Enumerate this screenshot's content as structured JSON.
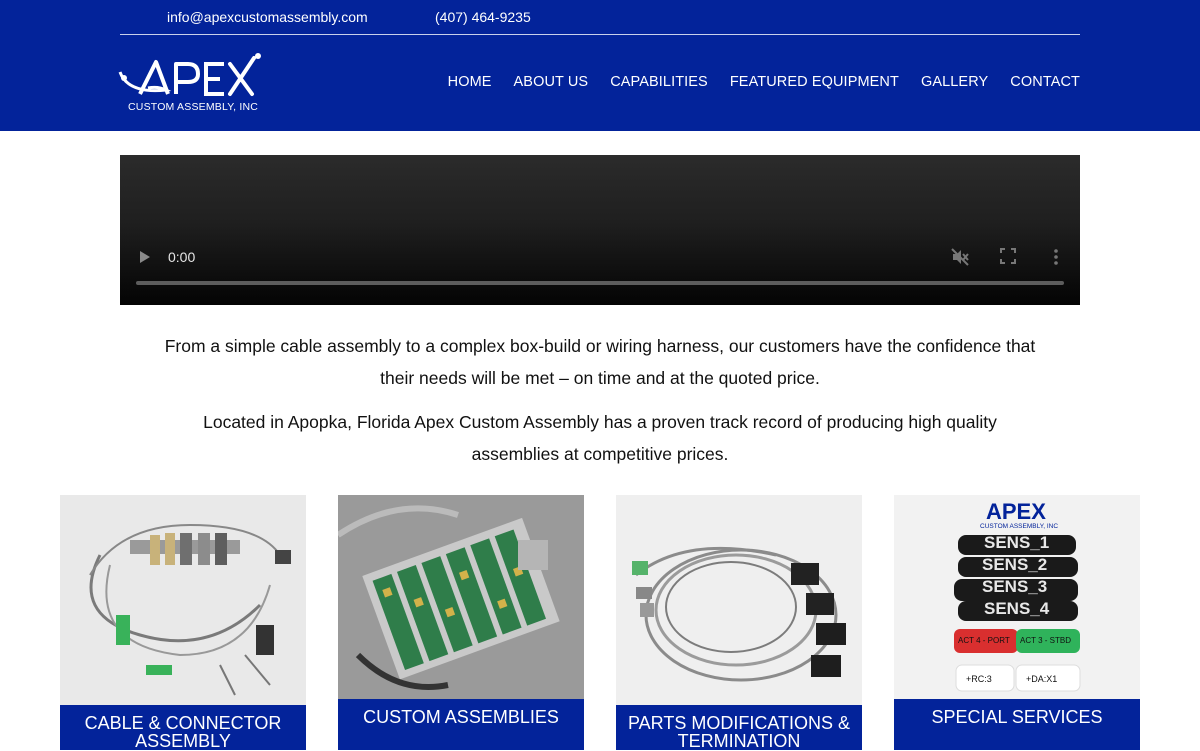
{
  "topbar": {
    "email": "info@apexcustomassembly.com",
    "phone": "(407) 464-9235"
  },
  "logo": {
    "wordmark": "APEX",
    "tagline": "CUSTOM ASSEMBLY, INC"
  },
  "nav": {
    "items": [
      {
        "label": "HOME"
      },
      {
        "label": "ABOUT US"
      },
      {
        "label": "CAPABILITIES"
      },
      {
        "label": "FEATURED EQUIPMENT"
      },
      {
        "label": "GALLERY"
      },
      {
        "label": "CONTACT"
      }
    ]
  },
  "video": {
    "time": "0:00",
    "icons": [
      "play-icon",
      "mute-icon",
      "fullscreen-icon",
      "more-options-icon"
    ]
  },
  "intro": {
    "p1": "From a simple cable assembly to a complex box-build or wiring harness, our customers have the confidence that their needs will be met – on time and at the quoted price.",
    "p2": "Located in Apopka, Florida Apex Custom Assembly has a proven track record of producing high quality assemblies at competitive prices."
  },
  "cards": [
    {
      "label": "CABLE & CONNECTOR ASSEMBLY"
    },
    {
      "label": "CUSTOM ASSEMBLIES"
    },
    {
      "label": "PARTS MODIFICATIONS & TERMINATION"
    },
    {
      "label": "SPECIAL SERVICES",
      "image_text": {
        "logo": "APEX",
        "tagline": "CUSTOM ASSEMBLY, INC",
        "tags": [
          "SENS_1",
          "SENS_2",
          "SENS_3",
          "SENS_4"
        ],
        "colored_tags": [
          "ACT 4 - PORT",
          "ACT 3 - STBD"
        ],
        "white_tags": [
          "+RC:3",
          "+DA:X1"
        ]
      }
    }
  ],
  "colors": {
    "brand_blue": "#03239a",
    "white": "#ffffff"
  }
}
